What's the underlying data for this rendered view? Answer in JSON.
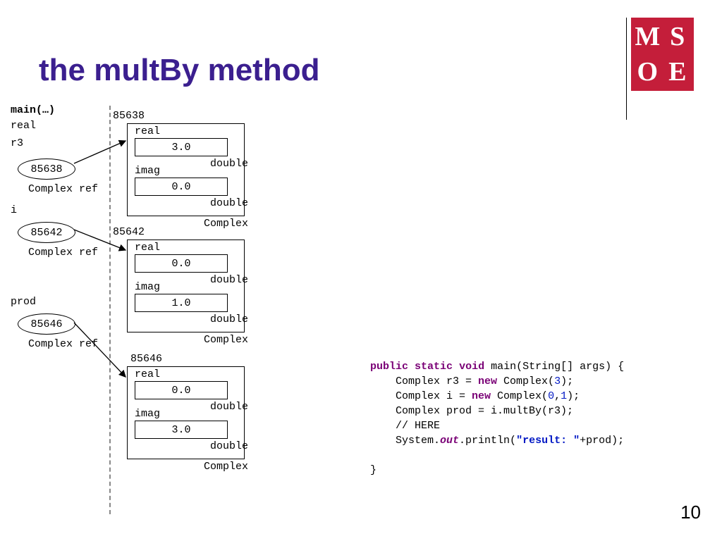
{
  "title": "the multBy method",
  "logo": {
    "tl": "M",
    "tr": "S",
    "bl": "O",
    "br": "E"
  },
  "page_number": "10",
  "stack": {
    "main_label": "main(…)",
    "real_label": "real",
    "r3": {
      "label": "r3",
      "value": "85638",
      "type": "Complex ref"
    },
    "i": {
      "label": "i",
      "value": "85642",
      "type": "Complex ref"
    },
    "prod": {
      "label": "prod",
      "value": "85646",
      "type": "Complex ref"
    }
  },
  "heap": {
    "obj1": {
      "addr": "85638",
      "real_label": "real",
      "real": "3.0",
      "imag_label": "imag",
      "imag": "0.0",
      "dtype": "double",
      "ctype": "Complex"
    },
    "obj2": {
      "addr": "85642",
      "real_label": "real",
      "real": "0.0",
      "imag_label": "imag",
      "imag": "1.0",
      "dtype": "double",
      "ctype": "Complex"
    },
    "obj3": {
      "addr": "85646",
      "real_label": "real",
      "real": "0.0",
      "imag_label": "imag",
      "imag": "3.0",
      "dtype": "double",
      "ctype": "Complex"
    }
  },
  "code": {
    "kw_public": "public",
    "kw_static": "static",
    "kw_void": "void",
    "main_sig": " main(String[] args) {",
    "l2a": "    Complex r3 = ",
    "kw_new1": "new",
    "l2b": " Complex(",
    "num3": "3",
    "l2c": ");",
    "l3a": "    Complex i = ",
    "kw_new2": "new",
    "l3b": " Complex(",
    "num0": "0",
    "comma": ",",
    "num1": "1",
    "l3c": ");",
    "l4": "    Complex prod = i.multBy(r3);",
    "l5": "    // HERE",
    "l6a": "    System.",
    "out": "out",
    "l6b": ".println(",
    "str": "\"result: \"",
    "l6c": "+prod);",
    "l7": "}"
  }
}
